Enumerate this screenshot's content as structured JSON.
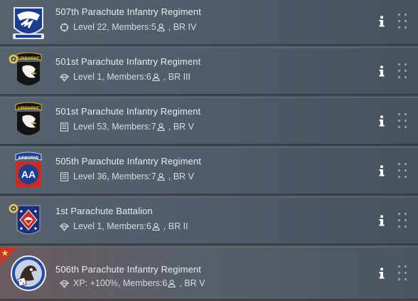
{
  "rows": [
    {
      "name": "507th Parachute Infantry Regiment",
      "level": "Level 22",
      "members_label": "Members:5",
      "br": "BR IV",
      "status_icon": "crosshair-icon",
      "emblem": "507th-pir-emblem",
      "selected": false,
      "has_badge": false
    },
    {
      "name": "501st Parachute Infantry Regiment",
      "level": "Level 1",
      "members_label": "Members:6",
      "br": "BR III",
      "status_icon": "parachute-icon",
      "emblem": "101st-airborne-emblem",
      "selected": false,
      "has_badge": true
    },
    {
      "name": "501st Parachute Infantry Regiment",
      "level": "Level 53",
      "members_label": "Members:7",
      "br": "BR V",
      "status_icon": "list-icon",
      "emblem": "101st-airborne-emblem",
      "selected": false,
      "has_badge": false
    },
    {
      "name": "505th Parachute Infantry Regiment",
      "level": "Level 36",
      "members_label": "Members:7",
      "br": "BR V",
      "status_icon": "list-icon",
      "emblem": "82nd-airborne-emblem",
      "selected": false,
      "has_badge": false
    },
    {
      "name": "1st Parachute Battalion",
      "level": "Level 1",
      "members_label": "Members:6",
      "br": "BR II",
      "status_icon": "parachute-icon",
      "emblem": "1st-parachute-battalion-emblem",
      "selected": false,
      "has_badge": true
    },
    {
      "name": "506th Parachute Infantry Regiment",
      "level": "XP: +100%",
      "members_label": "Members:6",
      "br": "BR V",
      "status_icon": "parachute-icon",
      "emblem": "506th-pir-emblem",
      "selected": true,
      "has_badge": false
    }
  ],
  "colors": {
    "text": "#e8edf1",
    "subtext": "#d5dbe0",
    "row_bg": "#4e5b68",
    "corner_red": "#c0392b"
  }
}
